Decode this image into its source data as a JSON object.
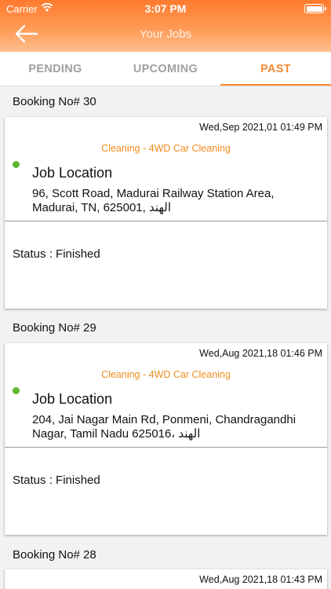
{
  "status_bar": {
    "carrier": "Carrier",
    "time": "3:07 PM"
  },
  "header": {
    "title": "Your Jobs"
  },
  "tabs": [
    {
      "label": "PENDING"
    },
    {
      "label": "UPCOMING"
    },
    {
      "label": "PAST",
      "active": true
    }
  ],
  "colors": {
    "accent": "#f58a30",
    "service": "#f08c1e",
    "status_dot": "#5cb830"
  },
  "bookings": [
    {
      "label": "Booking No#  30",
      "date": "Wed,Sep 2021,01 01:49 PM",
      "service": "Cleaning - 4WD Car Cleaning",
      "location_title": "Job Location",
      "address": "96, Scott Road, Madurai Railway Station Area, Madurai, TN, 625001, الهند",
      "status": "Status : Finished"
    },
    {
      "label": "Booking No#  29",
      "date": "Wed,Aug 2021,18 01:46 PM",
      "service": "Cleaning - 4WD Car Cleaning",
      "location_title": "Job Location",
      "address": "204, Jai Nagar Main Rd, Ponmeni, Chandragandhi Nagar, Tamil Nadu 625016، الهند",
      "status": "Status : Finished"
    },
    {
      "label": "Booking No#  28",
      "date": "Wed,Aug 2021,18 01:43 PM"
    }
  ]
}
